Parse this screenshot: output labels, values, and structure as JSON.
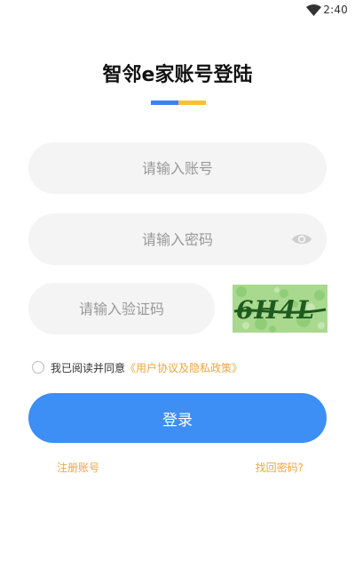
{
  "status_bar": {
    "time": "2:40",
    "icons": [
      "wifi-icon"
    ]
  },
  "header": {
    "title": "智邻e家账号登陆",
    "accent_colors": [
      "#3b82f6",
      "#f7c22f"
    ]
  },
  "form": {
    "account_placeholder": "请输入账号",
    "password_placeholder": "请输入密码",
    "captcha_placeholder": "请输入验证码",
    "captcha_text": "6H4L",
    "password_toggle_icon": "eye-icon"
  },
  "agreement": {
    "text": "我已阅读并同意",
    "link": "《用户协议及隐私政策》",
    "checked": false
  },
  "actions": {
    "login_label": "登录",
    "register_label": "注册账号",
    "forgot_label": "找回密码?"
  },
  "colors": {
    "primary": "#3d8ef5",
    "link": "#f0a640",
    "field_bg": "#f4f4f4"
  }
}
